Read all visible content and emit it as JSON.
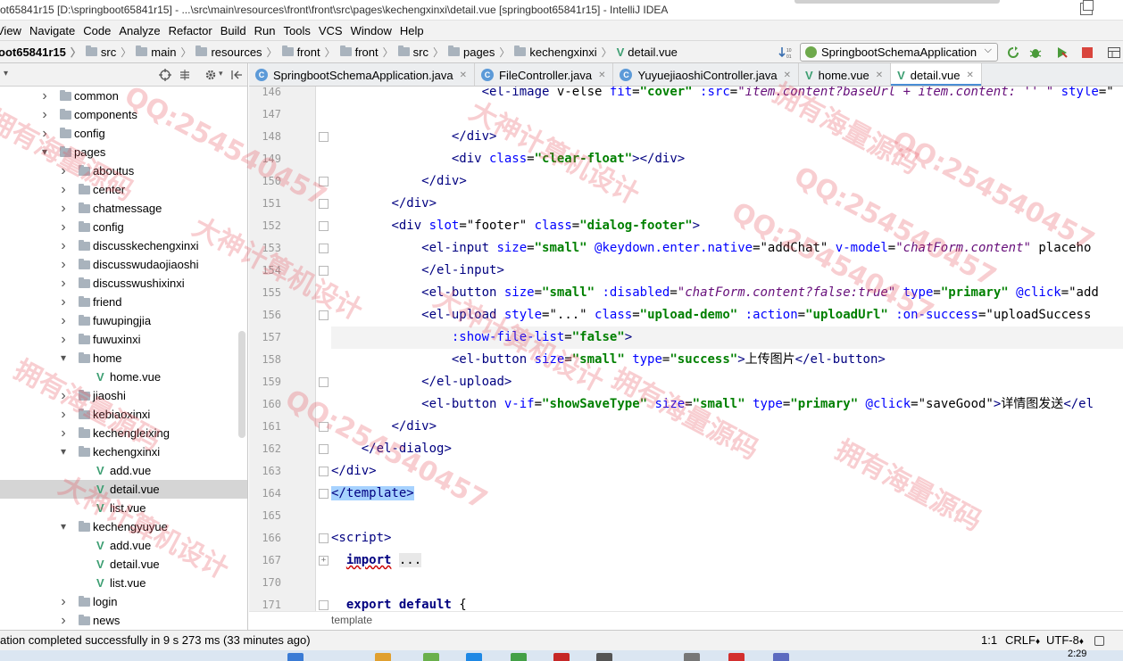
{
  "window": {
    "title": "ot65841r15 [D:\\springboot65841r15] - ...\\src\\main\\resources\\front\\front\\src\\pages\\kechengxinxi\\detail.vue [springboot65841r15] - IntelliJ IDEA"
  },
  "menu": [
    "View",
    "Navigate",
    "Code",
    "Analyze",
    "Refactor",
    "Build",
    "Run",
    "Tools",
    "VCS",
    "Window",
    "Help"
  ],
  "breadcrumbs": [
    "oot65841r15",
    "src",
    "main",
    "resources",
    "front",
    "front",
    "src",
    "pages",
    "kechengxinxi",
    "detail.vue"
  ],
  "run_config": "SpringbootSchemaApplication",
  "tree": [
    {
      "label": "common",
      "depth": 1,
      "type": "folder",
      "expanded": false
    },
    {
      "label": "components",
      "depth": 1,
      "type": "folder",
      "expanded": false
    },
    {
      "label": "config",
      "depth": 1,
      "type": "folder",
      "expanded": false
    },
    {
      "label": "pages",
      "depth": 1,
      "type": "folder",
      "expanded": true
    },
    {
      "label": "aboutus",
      "depth": 2,
      "type": "folder",
      "expanded": false
    },
    {
      "label": "center",
      "depth": 2,
      "type": "folder",
      "expanded": false
    },
    {
      "label": "chatmessage",
      "depth": 2,
      "type": "folder",
      "expanded": false
    },
    {
      "label": "config",
      "depth": 2,
      "type": "folder",
      "expanded": false
    },
    {
      "label": "discusskechengxinxi",
      "depth": 2,
      "type": "folder",
      "expanded": false
    },
    {
      "label": "discusswudaojiaoshi",
      "depth": 2,
      "type": "folder",
      "expanded": false
    },
    {
      "label": "discusswushixinxi",
      "depth": 2,
      "type": "folder",
      "expanded": false
    },
    {
      "label": "friend",
      "depth": 2,
      "type": "folder",
      "expanded": false
    },
    {
      "label": "fuwupingjia",
      "depth": 2,
      "type": "folder",
      "expanded": false
    },
    {
      "label": "fuwuxinxi",
      "depth": 2,
      "type": "folder",
      "expanded": false
    },
    {
      "label": "home",
      "depth": 2,
      "type": "folder",
      "expanded": true
    },
    {
      "label": "home.vue",
      "depth": 3,
      "type": "vue"
    },
    {
      "label": "jiaoshi",
      "depth": 2,
      "type": "folder",
      "expanded": false
    },
    {
      "label": "kebiaoxinxi",
      "depth": 2,
      "type": "folder",
      "expanded": false
    },
    {
      "label": "kechengleixing",
      "depth": 2,
      "type": "folder",
      "expanded": false
    },
    {
      "label": "kechengxinxi",
      "depth": 2,
      "type": "folder",
      "expanded": true
    },
    {
      "label": "add.vue",
      "depth": 3,
      "type": "vue"
    },
    {
      "label": "detail.vue",
      "depth": 3,
      "type": "vue",
      "selected": true
    },
    {
      "label": "list.vue",
      "depth": 3,
      "type": "vue"
    },
    {
      "label": "kechengyuyue",
      "depth": 2,
      "type": "folder",
      "expanded": true
    },
    {
      "label": "add.vue",
      "depth": 3,
      "type": "vue"
    },
    {
      "label": "detail.vue",
      "depth": 3,
      "type": "vue"
    },
    {
      "label": "list.vue",
      "depth": 3,
      "type": "vue"
    },
    {
      "label": "login",
      "depth": 2,
      "type": "folder",
      "expanded": false
    },
    {
      "label": "news",
      "depth": 2,
      "type": "folder",
      "expanded": false
    }
  ],
  "tabs": [
    {
      "label": "SpringbootSchemaApplication.java",
      "icon": "class-icon"
    },
    {
      "label": "FileController.java",
      "icon": "class-icon"
    },
    {
      "label": "YuyuejiaoshiController.java",
      "icon": "class-icon"
    },
    {
      "label": "home.vue",
      "icon": "vue-icon"
    },
    {
      "label": "detail.vue",
      "icon": "vue-icon",
      "active": true
    }
  ],
  "code": [
    {
      "n": "146",
      "text": "                    <el-image v-else fit=\"cover\" :src=\"item.content?baseUrl + item.content: '' \" style=\""
    },
    {
      "n": "147",
      "text": ""
    },
    {
      "n": "148",
      "text": "                </div>"
    },
    {
      "n": "149",
      "text": "                <div class=\"clear-float\"></div>"
    },
    {
      "n": "150",
      "text": "            </div>"
    },
    {
      "n": "151",
      "text": "        </div>"
    },
    {
      "n": "152",
      "text": "        <div slot=\"footer\" class=\"dialog-footer\">"
    },
    {
      "n": "153",
      "text": "            <el-input size=\"small\" @keydown.enter.native=\"addChat\" v-model=\"chatForm.content\" placeho"
    },
    {
      "n": "154",
      "text": "            </el-input>"
    },
    {
      "n": "155",
      "text": "            <el-button size=\"small\" :disabled=\"chatForm.content?false:true\" type=\"primary\" @click=\"add"
    },
    {
      "n": "156",
      "text": "            <el-upload style=\"...\" class=\"upload-demo\" :action=\"uploadUrl\" :on-success=\"uploadSuccess"
    },
    {
      "n": "157",
      "text": "                :show-file-list=\"false\">"
    },
    {
      "n": "158",
      "text": "                <el-button size=\"small\" type=\"success\">上传图片</el-button>"
    },
    {
      "n": "159",
      "text": "            </el-upload>"
    },
    {
      "n": "160",
      "text": "            <el-button v-if=\"showSaveType\" size=\"small\" type=\"primary\" @click=\"saveGood\">详情图发送</el"
    },
    {
      "n": "161",
      "text": "        </div>"
    },
    {
      "n": "162",
      "text": "    </el-dialog>"
    },
    {
      "n": "163",
      "text": "</div>"
    },
    {
      "n": "164",
      "text": "</template>"
    },
    {
      "n": "165",
      "text": ""
    },
    {
      "n": "166",
      "text": "<script>"
    },
    {
      "n": "167",
      "text": "  import ..."
    },
    {
      "n": "170",
      "text": ""
    },
    {
      "n": "171",
      "text": "  export default {"
    }
  ],
  "editor_breadcrumb": "template",
  "status": {
    "message": "ation completed successfully in 9 s 273 ms (33 minutes ago)",
    "position": "1:1",
    "line_sep": "CRLF",
    "encoding": "UTF-8"
  },
  "clock": "2:29",
  "watermarks": [
    "拥有海量源码",
    "QQ:254540457",
    "大神计算机设计",
    "拥有海量源码",
    "QQ:254540457",
    "大神计算机设计",
    "QQ:254540457",
    "拥有海量源码",
    "大神计算机设计",
    "QQ:254540457",
    "拥有海量源码",
    "大神计算机设计",
    "QQ:254540457",
    "拥有海量源码"
  ],
  "colors": {
    "accent": "#4a8ed6",
    "vue": "#3e9f73",
    "selection": "#a6d2ff",
    "watermark": "#e6505a"
  }
}
